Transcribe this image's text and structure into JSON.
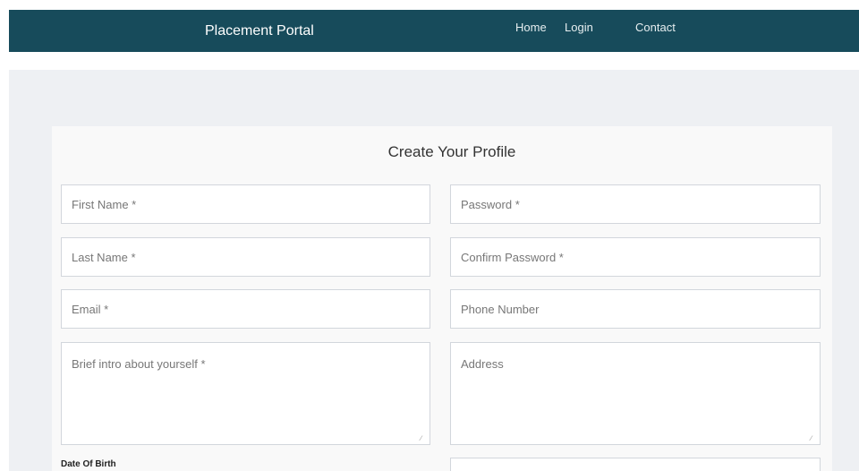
{
  "navbar": {
    "brand": "Placement Portal",
    "links": [
      {
        "label": "Home"
      },
      {
        "label": "Login"
      },
      {
        "label": "Contact"
      }
    ]
  },
  "form": {
    "title": "Create Your Profile",
    "fields": {
      "first_name": {
        "placeholder": "First Name *"
      },
      "password": {
        "placeholder": "Password *"
      },
      "last_name": {
        "placeholder": "Last Name *"
      },
      "confirm_password": {
        "placeholder": "Confirm Password *"
      },
      "email": {
        "placeholder": "Email *"
      },
      "phone": {
        "placeholder": "Phone Number"
      },
      "intro": {
        "placeholder": "Brief intro about yourself *"
      },
      "address": {
        "placeholder": "Address"
      }
    },
    "dob_label": "Date Of Birth"
  }
}
